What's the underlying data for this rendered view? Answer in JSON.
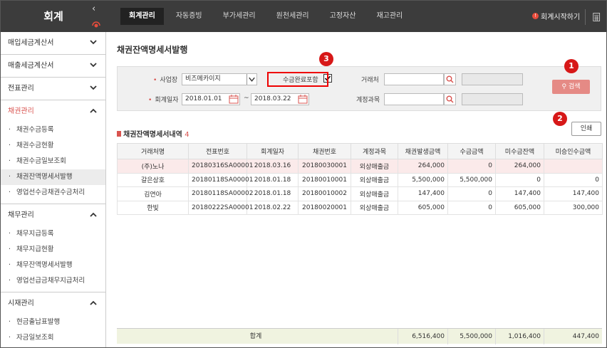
{
  "topbar": {
    "app_title": "회계",
    "tabs": [
      "회계관리",
      "자동증빙",
      "부가세관리",
      "원천세관리",
      "고정자산",
      "재고관리"
    ],
    "start_label": "회계시작하기"
  },
  "sidebar": {
    "sections": [
      {
        "label": "매입세금계산서",
        "items": []
      },
      {
        "label": "매출세금계산서",
        "items": []
      },
      {
        "label": "전표관리",
        "items": []
      },
      {
        "label": "채권관리",
        "items": [
          "채권수금등록",
          "채권수금현황",
          "채권수금일보조회",
          "채권잔액명세서발행",
          "영업선수금채권수금처리"
        ]
      },
      {
        "label": "채무관리",
        "items": [
          "채무지급등록",
          "채무지급현황",
          "채무잔액명세서발행",
          "영업선급금채무지급처리"
        ]
      },
      {
        "label": "시재관리",
        "items": [
          "현금출납표발행",
          "자금일보조회"
        ]
      }
    ]
  },
  "main": {
    "page_title": "채권잔액명세서발행",
    "filter": {
      "site_label": "사업장",
      "site_value": "비즈메카이지",
      "include_label": "수금완료포함",
      "date_label": "회계일자",
      "date_from": "2018.01.01",
      "date_sep": "~",
      "date_to": "2018.03.22",
      "client_label": "거래처",
      "account_label": "계정과목",
      "search_label": "검색"
    },
    "print_label": "인쇄",
    "list_title": "채권잔액명세서내역",
    "list_count": "4",
    "badges": [
      "1",
      "2",
      "3"
    ],
    "columns": [
      "거래처명",
      "전표번호",
      "회계일자",
      "채권번호",
      "계정과목",
      "채권발생금액",
      "수금금액",
      "미수금잔액",
      "미승인수금액"
    ],
    "rows": [
      [
        "(주)노나",
        "20180316SA00001",
        "2018.03.16",
        "20180030001",
        "외상매출금",
        "264,000",
        "0",
        "264,000",
        ""
      ],
      [
        "갈은상호",
        "20180118SA00001",
        "2018.01.18",
        "20180010001",
        "외상매출금",
        "5,500,000",
        "5,500,000",
        "0",
        "0"
      ],
      [
        "김연아",
        "20180118SA00002",
        "2018.01.18",
        "20180010002",
        "외상매출금",
        "147,400",
        "0",
        "147,400",
        "147,400"
      ],
      [
        "한빛",
        "20180222SA00001",
        "2018.02.22",
        "20180020001",
        "외상매출금",
        "605,000",
        "0",
        "605,000",
        "300,000"
      ]
    ],
    "total": {
      "label": "합계",
      "values": [
        "6,516,400",
        "5,500,000",
        "1,016,400",
        "447,400"
      ]
    }
  },
  "colors": {
    "accent": "#d9534f",
    "topbar": "#3c3c3c",
    "badge": "#d71818"
  }
}
